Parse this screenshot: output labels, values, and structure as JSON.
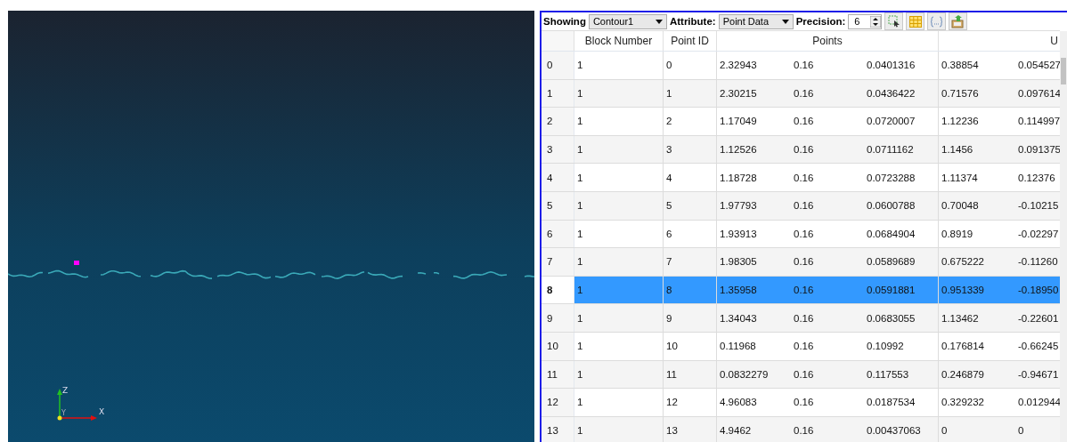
{
  "viewport": {
    "axes": {
      "x": "X",
      "y": "Y",
      "z": "Z"
    }
  },
  "toolbar": {
    "showing_label": "Showing",
    "showing_value": "Contour1",
    "attribute_label": "Attribute:",
    "attribute_value": "Point Data",
    "precision_label": "Precision:",
    "precision_value": "6"
  },
  "table": {
    "columns": [
      "Block Number",
      "Point ID",
      "",
      "Points",
      "",
      "",
      "U"
    ],
    "rows": [
      {
        "index": "0",
        "cells": [
          "1",
          "0",
          "2.32943",
          "0.16",
          "0.0401316",
          "0.38854",
          "0.054527"
        ],
        "selected": false
      },
      {
        "index": "1",
        "cells": [
          "1",
          "1",
          "2.30215",
          "0.16",
          "0.0436422",
          "0.71576",
          "0.097614"
        ],
        "selected": false
      },
      {
        "index": "2",
        "cells": [
          "1",
          "2",
          "1.17049",
          "0.16",
          "0.0720007",
          "1.12236",
          "0.114997"
        ],
        "selected": false
      },
      {
        "index": "3",
        "cells": [
          "1",
          "3",
          "1.12526",
          "0.16",
          "0.0711162",
          "1.1456",
          "0.091375"
        ],
        "selected": false
      },
      {
        "index": "4",
        "cells": [
          "1",
          "4",
          "1.18728",
          "0.16",
          "0.0723288",
          "1.11374",
          "0.12376"
        ],
        "selected": false
      },
      {
        "index": "5",
        "cells": [
          "1",
          "5",
          "1.97793",
          "0.16",
          "0.0600788",
          "0.70048",
          "-0.10215"
        ],
        "selected": false
      },
      {
        "index": "6",
        "cells": [
          "1",
          "6",
          "1.93913",
          "0.16",
          "0.0684904",
          "0.8919",
          "-0.02297"
        ],
        "selected": false
      },
      {
        "index": "7",
        "cells": [
          "1",
          "7",
          "1.98305",
          "0.16",
          "0.0589689",
          "0.675222",
          "-0.11260"
        ],
        "selected": false
      },
      {
        "index": "8",
        "cells": [
          "1",
          "8",
          "1.35958",
          "0.16",
          "0.0591881",
          "0.951339",
          "-0.18950"
        ],
        "selected": true
      },
      {
        "index": "9",
        "cells": [
          "1",
          "9",
          "1.34043",
          "0.16",
          "0.0683055",
          "1.13462",
          "-0.22601"
        ],
        "selected": false
      },
      {
        "index": "10",
        "cells": [
          "1",
          "10",
          "0.11968",
          "0.16",
          "0.10992",
          "0.176814",
          "-0.66245"
        ],
        "selected": false
      },
      {
        "index": "11",
        "cells": [
          "1",
          "11",
          "0.0832279",
          "0.16",
          "0.117553",
          "0.246879",
          "-0.94671"
        ],
        "selected": false
      },
      {
        "index": "12",
        "cells": [
          "1",
          "12",
          "4.96083",
          "0.16",
          "0.0187534",
          "0.329232",
          "0.012944"
        ],
        "selected": false
      },
      {
        "index": "13",
        "cells": [
          "1",
          "13",
          "4.9462",
          "0.16",
          "0.00437063",
          "0",
          "0"
        ],
        "selected": false
      }
    ]
  }
}
